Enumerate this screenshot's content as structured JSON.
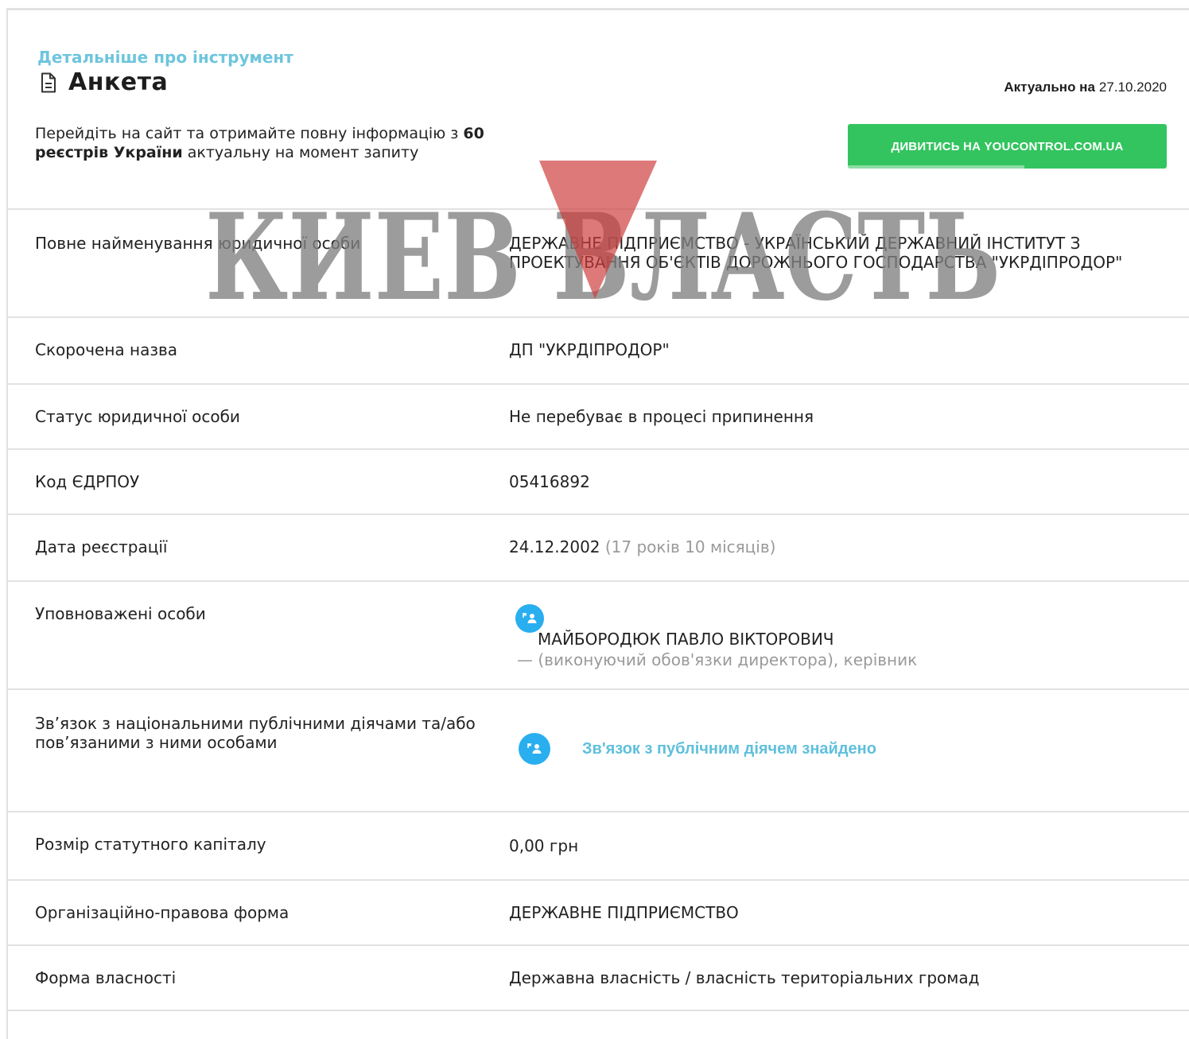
{
  "header": {
    "more_link": "Детальніше про інструмент",
    "title": "Анкета",
    "actual_label": "Актуально на",
    "actual_date": "27.10.2020"
  },
  "intro": {
    "part1": "Перейдіть на сайт та отримайте повну інформацію з",
    "count": "60",
    "bold": "реєстрів України",
    "part2": "актуальну на момент запиту"
  },
  "cta": {
    "label": "ДИВИТИСЬ НА YOUCONTROL.COM.UA",
    "color": "#33c45f"
  },
  "watermark": {
    "text": "КИЕВ ВЛАСТЬ"
  },
  "rows": {
    "full_name": {
      "label": "Повне найменування юридичної особи",
      "value": "ДЕРЖАВНЕ ПІДПРИЄМСТВО - УКРАЇНСЬКИЙ ДЕРЖАВНИЙ ІНСТИТУТ З ПРОЕКТУВАННЯ ОБ'ЄКТІВ ДОРОЖНЬОГО ГОСПОДАРСТВА \"УКРДІПРОДОР\""
    },
    "short_name": {
      "label": "Скорочена назва",
      "value": "ДП \"УКРДІПРОДОР\""
    },
    "status": {
      "label": "Статус юридичної особи",
      "value": "Не перебуває в процесі припинення"
    },
    "edrpou": {
      "label": "Код ЄДРПОУ",
      "value": "05416892"
    },
    "reg_date": {
      "label": "Дата реєстрації",
      "value": "24.12.2002",
      "age": "(17 років 10 місяців)"
    },
    "authorized": {
      "label": "Уповноважені особи",
      "person_icon": "person-flag-icon",
      "name": "МАЙБОРОДЮК ПАВЛО ВІКТОРОВИЧ",
      "role": "— (виконуючий обов'язки директора), керівник"
    },
    "pep": {
      "label": "Зв’язок з національними публічними діячами та/або пов’язаними з ними особами",
      "link": "Зв'язок з публічним діячем знайдено"
    },
    "capital": {
      "label": "Розмір статутного капіталу",
      "value": "0,00 грн"
    },
    "legal_form": {
      "label": "Організаційно-правова форма",
      "value": "ДЕРЖАВНЕ ПІДПРИЄМСТВО"
    },
    "ownership": {
      "label": "Форма власності",
      "value": "Державна власність / власність територіальних громад"
    }
  },
  "colors": {
    "accent_link": "#5fc0dc",
    "badge": "#29aef0",
    "button": "#33c45f"
  }
}
